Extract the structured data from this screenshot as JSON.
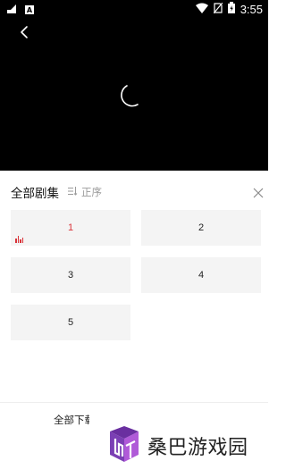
{
  "status_bar": {
    "time": "3:55",
    "left_badge": "A",
    "icons": [
      "signal-data-icon",
      "wifi-icon",
      "no-sim-icon",
      "battery-charging-icon"
    ]
  },
  "player": {
    "back_icon": "back-chevron-icon",
    "loading_icon": "loading-spinner-icon"
  },
  "episodes_panel": {
    "title": "全部剧集",
    "sort_label": "正序",
    "sort_icon": "sort-list-icon",
    "close_icon": "close-icon",
    "episodes": [
      {
        "label": "1",
        "active": true
      },
      {
        "label": "2",
        "active": false
      },
      {
        "label": "3",
        "active": false
      },
      {
        "label": "4",
        "active": false
      },
      {
        "label": "5",
        "active": false
      }
    ],
    "active_color": "#d9343a"
  },
  "footer": {
    "download_label": "全部下载"
  },
  "watermark": {
    "text": "桑巴游戏园"
  }
}
